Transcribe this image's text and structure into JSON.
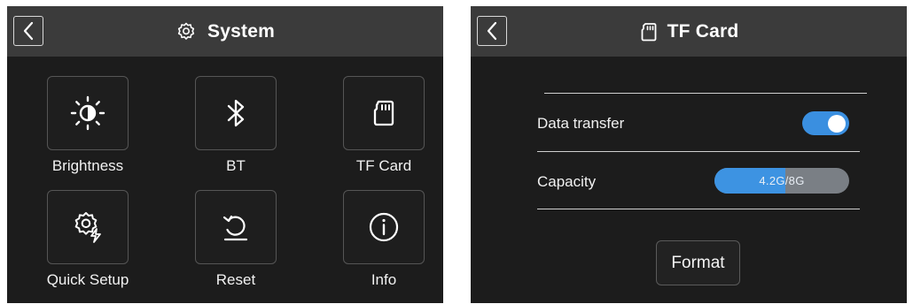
{
  "system_screen": {
    "title": "System",
    "title_icon": "gear-icon",
    "back_icon": "chevron-left-icon",
    "tiles": [
      {
        "label": "Brightness",
        "icon": "brightness-icon"
      },
      {
        "label": "BT",
        "icon": "bluetooth-icon"
      },
      {
        "label": "TF Card",
        "icon": "sd-card-icon"
      },
      {
        "label": "Quick Setup",
        "icon": "quick-setup-gear-icon"
      },
      {
        "label": "Reset",
        "icon": "reset-icon"
      },
      {
        "label": "Info",
        "icon": "info-icon"
      }
    ]
  },
  "tfcard_screen": {
    "title": "TF Card",
    "title_icon": "sd-card-icon",
    "back_icon": "chevron-left-icon",
    "data_transfer": {
      "label": "Data transfer",
      "enabled": true
    },
    "capacity": {
      "label": "Capacity",
      "text": "4.2G/8G",
      "used_gb": 4.2,
      "total_gb": 8
    },
    "format_label": "Format"
  },
  "colors": {
    "accent": "#3a8fe0",
    "titlebar": "#3b3b3b",
    "background": "#1c1c1c",
    "capacity_track": "#7a7f85"
  }
}
